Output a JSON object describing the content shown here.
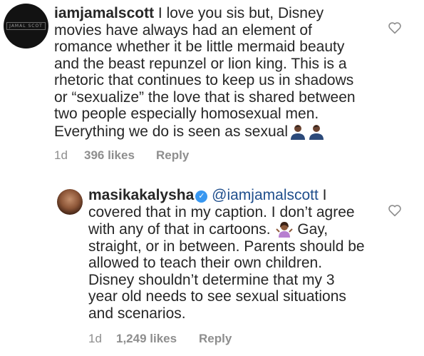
{
  "comments": [
    {
      "username": "iamjamalscott",
      "avatar_logo": "JAMAL SCOT",
      "text": " I love you sis but, Disney\nmovies have always had an element of\nromance whether it be little mermaid beauty\nand the beast repunzel or lion king. This is a\nrhetoric that continues to keep us in shadows\nor “sexualize” the love that is shared between\ntwo people especially homosexual men.\nEverything we do is seen as sexual",
      "emojis": [
        "person-icon",
        "person-icon"
      ],
      "time": "1d",
      "likes": "396 likes",
      "reply": "Reply"
    },
    {
      "username": "masikakalysha",
      "verified": true,
      "mention": "@iamjamalscott",
      "text_part1": " I\ncovered that in my caption. I don’t agree\nwith any of that in cartoons. ",
      "emoji": "woman-shrugging-icon",
      "text_part2": " Gay,\nstraight, or in between. Parents should be\nallowed to teach their own children.\nDisney shouldn’t determine that my 3\nyear old needs to see sexual situations\nand scenarios.",
      "time": "1d",
      "likes": "1,249 likes",
      "reply": "Reply"
    }
  ],
  "colors": {
    "text": "#262626",
    "meta": "#8e8e8e",
    "mention": "#1f4e8c",
    "verified": "#3897f0"
  }
}
